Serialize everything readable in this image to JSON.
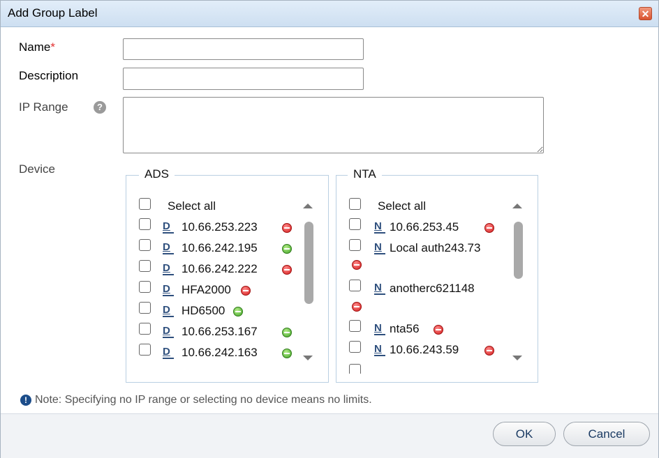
{
  "dialog": {
    "title": "Add Group Label",
    "close_glyph": "✕"
  },
  "form": {
    "name_label": "Name",
    "required_mark": "*",
    "name_value": "",
    "description_label": "Description",
    "description_value": "",
    "ip_range_label": "IP Range",
    "ip_range_help_glyph": "?",
    "ip_range_value": "",
    "device_label": "Device"
  },
  "ads": {
    "legend": "ADS",
    "select_all": "Select all",
    "items": [
      {
        "label": "10.66.253.223",
        "status": "red"
      },
      {
        "label": "10.66.242.195",
        "status": "green"
      },
      {
        "label": "10.66.242.222",
        "status": "red"
      },
      {
        "label": "HFA2000",
        "status": "red"
      },
      {
        "label": "HD6500",
        "status": "green"
      },
      {
        "label": "10.66.253.167",
        "status": "green"
      },
      {
        "label": "10.66.242.163",
        "status": "green"
      }
    ],
    "icon_glyph": "D"
  },
  "nta": {
    "legend": "NTA",
    "select_all": "Select all",
    "items": [
      {
        "label": "10.66.253.45",
        "status": "red"
      },
      {
        "label": "Local auth243.73",
        "status": "red"
      },
      {
        "label": "anotherc621148",
        "status": "red"
      },
      {
        "label": "nta56",
        "status": "red"
      },
      {
        "label": "10.66.243.59",
        "status": "red"
      }
    ],
    "icon_glyph": "N"
  },
  "note": {
    "icon_glyph": "!",
    "text": "Note: Specifying no IP range or selecting no device means no limits."
  },
  "buttons": {
    "ok": "OK",
    "cancel": "Cancel"
  },
  "colors": {
    "status_red": "#d41c1c",
    "status_green": "#40a326",
    "accent": "#1c4d8a"
  }
}
